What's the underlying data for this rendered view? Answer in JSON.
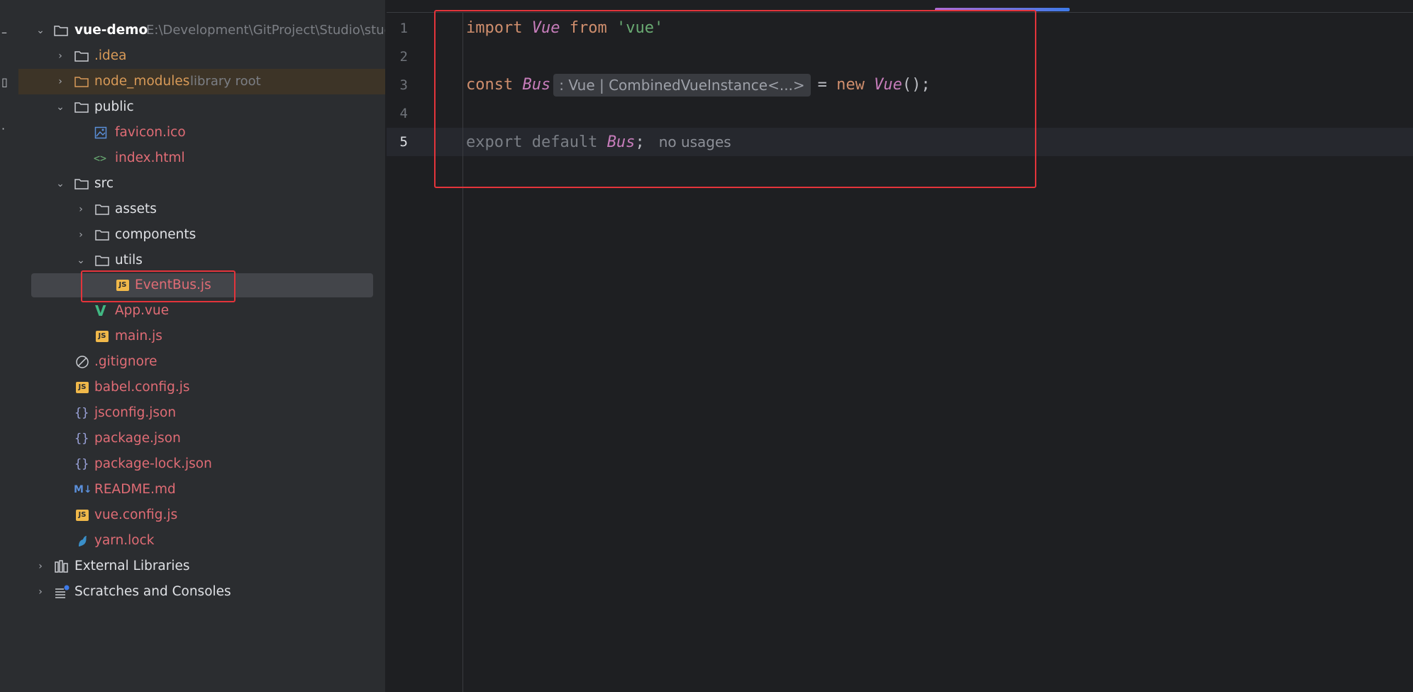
{
  "project_tree": {
    "root": {
      "name": "vue-demo",
      "path": "E:\\Development\\GitProject\\Studio\\stud"
    },
    "items": [
      {
        "label": ".idea"
      },
      {
        "label": "node_modules",
        "hint": "library root"
      },
      {
        "label": "public"
      },
      {
        "label": "favicon.ico"
      },
      {
        "label": "index.html"
      },
      {
        "label": "src"
      },
      {
        "label": "assets"
      },
      {
        "label": "components"
      },
      {
        "label": "utils"
      },
      {
        "label": "EventBus.js"
      },
      {
        "label": "App.vue"
      },
      {
        "label": "main.js"
      },
      {
        "label": ".gitignore"
      },
      {
        "label": "babel.config.js"
      },
      {
        "label": "jsconfig.json"
      },
      {
        "label": "package.json"
      },
      {
        "label": "package-lock.json"
      },
      {
        "label": "README.md"
      },
      {
        "label": "vue.config.js"
      },
      {
        "label": "yarn.lock"
      },
      {
        "label": "External Libraries"
      },
      {
        "label": "Scratches and Consoles"
      }
    ],
    "icons": {
      "js": "JS",
      "vue": "V",
      "json": "{}",
      "markdown": "M↓",
      "html": "<>"
    }
  },
  "editor": {
    "line_numbers": [
      "1",
      "2",
      "3",
      "4",
      "5"
    ],
    "lines": {
      "l1": {
        "kw_import": "import",
        "cls_vue": "Vue",
        "kw_from": "from",
        "str_vue": "'vue'"
      },
      "l3": {
        "kw_const": "const",
        "cls_bus": "Bus",
        "type_hint": ": Vue | CombinedVueInstance<...>",
        "op_eq": "=",
        "kw_new": "new",
        "cls_vue": "Vue",
        "tail": "();"
      },
      "l5": {
        "kw_export": "export default",
        "cls_bus": "Bus",
        "semi": ";",
        "usages": "no usages"
      }
    }
  },
  "colors": {
    "accent_red": "#e3343b",
    "keyword": "#cf8e6d",
    "class_name": "#c77dbb",
    "string": "#6aab73",
    "modified_file": "#e06c75"
  }
}
